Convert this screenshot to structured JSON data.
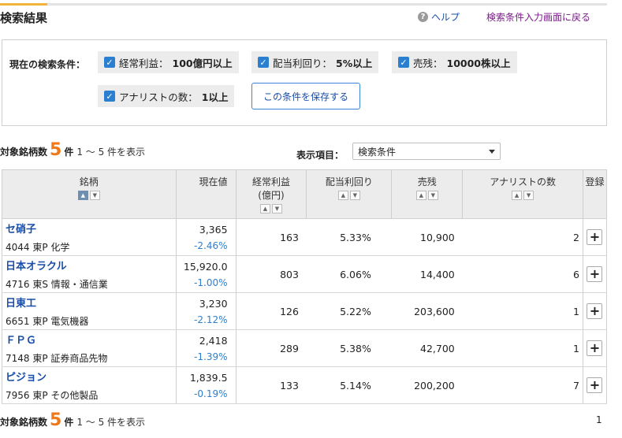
{
  "header": {
    "title": "検索結果",
    "help_label": "ヘルプ",
    "back_label": "検索条件入力画面に戻る"
  },
  "conditions": {
    "label": "現在の検索条件：",
    "items": [
      {
        "name": "経常利益：",
        "value": "100億円以上"
      },
      {
        "name": "配当利回り：",
        "value": "5%以上"
      },
      {
        "name": "売残：",
        "value": "10000株以上"
      },
      {
        "name": "アナリストの数：",
        "value": "1以上"
      }
    ],
    "save_label": "この条件を保存する"
  },
  "summary": {
    "label": "対象銘柄数",
    "count": "5",
    "unit": "件",
    "range": "1 〜 5 件を表示"
  },
  "display": {
    "label": "表示項目：",
    "selected": "検索条件"
  },
  "table": {
    "headers": {
      "name": "銘柄",
      "price": "現在値",
      "profit_line1": "経常利益",
      "profit_line2": "(億円)",
      "yield": "配当利回り",
      "short": "売残",
      "analysts": "アナリストの数",
      "register": "登録"
    },
    "rows": [
      {
        "name": "セ硝子",
        "sub": "4044 東P 化学",
        "price": "3,365",
        "change": "-2.46%",
        "profit": "163",
        "yield": "5.33%",
        "short": "10,900",
        "analysts": "2"
      },
      {
        "name": "日本オラクル",
        "sub": "4716 東S 情報・通信業",
        "price": "15,920.0",
        "change": "-1.00%",
        "profit": "803",
        "yield": "6.06%",
        "short": "14,400",
        "analysts": "6"
      },
      {
        "name": "日東工",
        "sub": "6651 東P 電気機器",
        "price": "3,230",
        "change": "-2.12%",
        "profit": "126",
        "yield": "5.22%",
        "short": "203,600",
        "analysts": "1"
      },
      {
        "name": "ＦＰＧ",
        "sub": "7148 東P 証券商品先物",
        "price": "2,418",
        "change": "-1.39%",
        "profit": "289",
        "yield": "5.38%",
        "short": "42,700",
        "analysts": "1"
      },
      {
        "name": "ピジョン",
        "sub": "7956 東P その他製品",
        "price": "1,839.5",
        "change": "-0.19%",
        "profit": "133",
        "yield": "5.14%",
        "short": "200,200",
        "analysts": "7"
      }
    ]
  },
  "pager": {
    "page": "1"
  },
  "icons": {
    "help": "help-icon",
    "checkbox": "checkbox-checked-icon",
    "plus": "plus-icon",
    "sort_asc": "sort-asc-icon",
    "sort_desc": "sort-desc-icon"
  },
  "colors": {
    "accent": "#f07818",
    "link": "#1a4da6",
    "visited": "#7b1a8a",
    "checkbox": "#2b7fd1"
  }
}
